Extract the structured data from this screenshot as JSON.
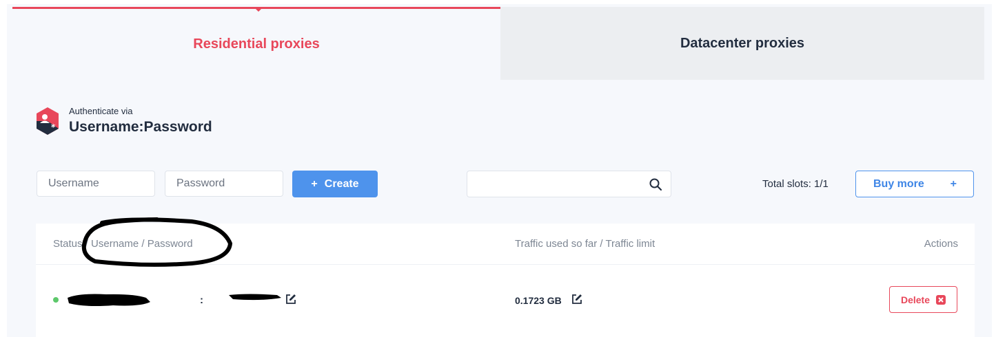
{
  "tabs": {
    "residential_label": "Residential proxies",
    "datacenter_label": "Datacenter proxies"
  },
  "auth": {
    "small_label": "Authenticate via",
    "method": "Username:Password",
    "icon": "user-key-hexagon-icon"
  },
  "toolbar": {
    "username_placeholder": "Username",
    "password_placeholder": "Password",
    "create_label": "Create",
    "create_icon": "+",
    "search_placeholder": "",
    "total_slots": "Total slots: 1/1",
    "buy_more_label": "Buy more",
    "buy_more_icon": "+"
  },
  "table": {
    "headers": {
      "user": "Status / Username / Password",
      "traffic": "Traffic used so far / Traffic limit",
      "actions": "Actions"
    },
    "rows": [
      {
        "status": "active",
        "separator": ":",
        "traffic": "0.1723 GB",
        "delete_label": "Delete"
      }
    ]
  },
  "colors": {
    "accent_red": "#e8475a",
    "accent_blue": "#4e93ec",
    "status_green": "#5dc86b",
    "text_dark": "#222d3f",
    "text_muted": "#7d8693"
  }
}
